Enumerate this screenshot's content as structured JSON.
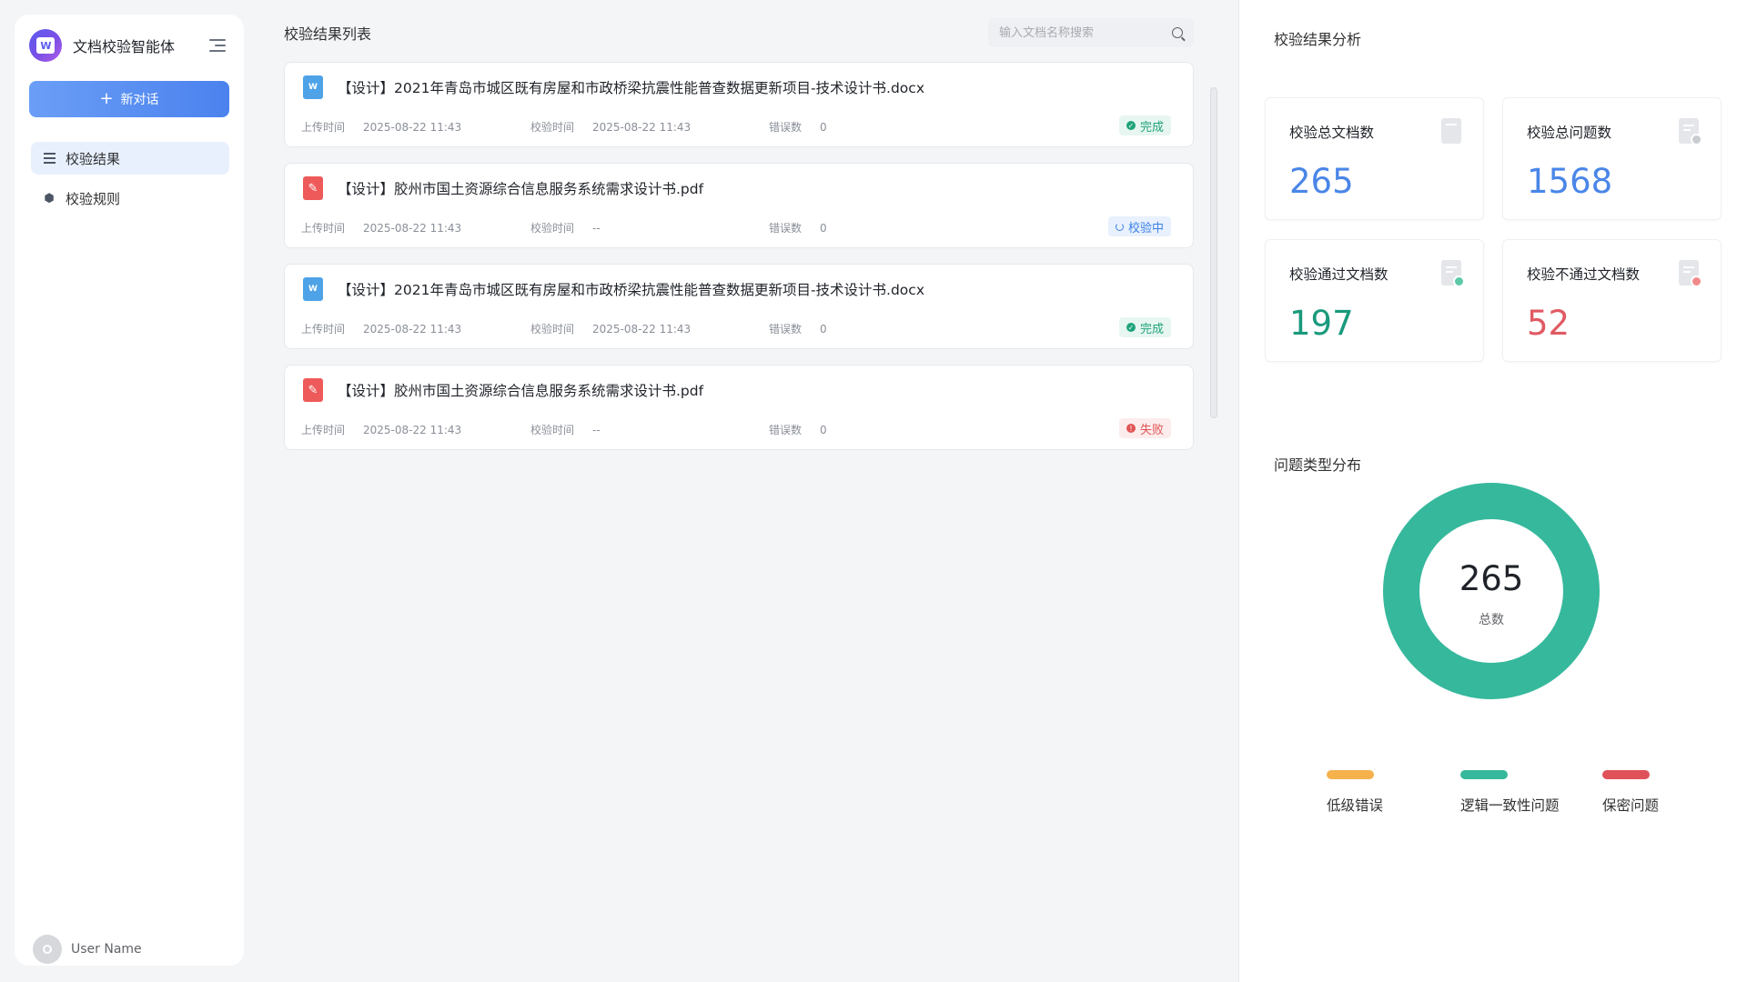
{
  "app": {
    "title": "文档校验智能体",
    "new_chat_label": "新对话",
    "user_name": "User Name"
  },
  "nav": {
    "items": [
      {
        "label": "校验结果",
        "icon": "list-icon",
        "active": true
      },
      {
        "label": "校验规则",
        "icon": "settings-cube-icon",
        "active": false
      }
    ]
  },
  "list": {
    "title": "校验结果列表",
    "search_placeholder": "输入文档名称搜索",
    "labels": {
      "upload": "上传时间",
      "check": "校验时间",
      "errors": "错误数"
    },
    "items": [
      {
        "type": "word",
        "name": "【设计】2021年青岛市城区既有房屋和市政桥梁抗震性能普查数据更新项目-技术设计书.docx",
        "upload_time": "2025-08-22 11:43",
        "check_time": "2025-08-22 11:43",
        "errors": "0",
        "status": "完成",
        "status_type": "done"
      },
      {
        "type": "pdf",
        "name": "【设计】胶州市国土资源综合信息服务系统需求设计书.pdf",
        "upload_time": "2025-08-22 11:43",
        "check_time": "--",
        "errors": "0",
        "status": "校验中",
        "status_type": "checking"
      },
      {
        "type": "word",
        "name": "【设计】2021年青岛市城区既有房屋和市政桥梁抗震性能普查数据更新项目-技术设计书.docx",
        "upload_time": "2025-08-22 11:43",
        "check_time": "2025-08-22 11:43",
        "errors": "0",
        "status": "完成",
        "status_type": "done"
      },
      {
        "type": "pdf",
        "name": "【设计】胶州市国土资源综合信息服务系统需求设计书.pdf",
        "upload_time": "2025-08-22 11:43",
        "check_time": "--",
        "errors": "0",
        "status": "失败",
        "status_type": "fail"
      }
    ]
  },
  "analysis": {
    "title": "校验结果分析",
    "stats": [
      {
        "label": "校验总文档数",
        "value": "265",
        "color": "#4a86e8",
        "icon": "document-icon"
      },
      {
        "label": "校验总问题数",
        "value": "1568",
        "color": "#4a86e8",
        "icon": "document-question-icon"
      },
      {
        "label": "校验通过文档数",
        "value": "197",
        "color": "#1a9a7c",
        "icon": "document-check-icon"
      },
      {
        "label": "校验不通过文档数",
        "value": "52",
        "color": "#e05a63",
        "icon": "document-error-icon"
      }
    ],
    "distribution_title": "问题类型分布",
    "donut": {
      "total": "265",
      "total_label": "总数"
    },
    "legend": [
      {
        "label": "低级错误",
        "color": "#f5b14c"
      },
      {
        "label": "逻辑一致性问题",
        "color": "#36b89c"
      },
      {
        "label": "保密问题",
        "color": "#e0525a"
      }
    ]
  }
}
